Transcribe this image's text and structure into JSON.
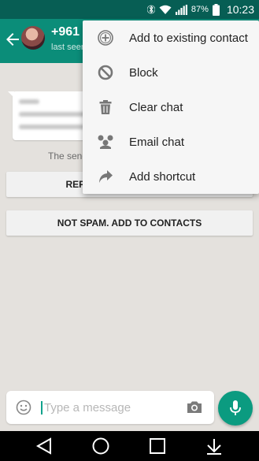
{
  "status_bar": {
    "battery": "87%",
    "time": "10:23"
  },
  "header": {
    "contact_name": "+961",
    "contact_status": "last seen"
  },
  "chat": {
    "sender_note": "The sender",
    "report_label": "REPORT SPAM AND BLOCK",
    "not_spam_label": "NOT SPAM. ADD TO CONTACTS"
  },
  "composer": {
    "placeholder": "Type a message"
  },
  "menu": {
    "items": [
      {
        "label": "Add to existing contact",
        "icon": "add-circle-icon"
      },
      {
        "label": "Block",
        "icon": "block-icon"
      },
      {
        "label": "Clear chat",
        "icon": "trash-icon"
      },
      {
        "label": "Email chat",
        "icon": "email-chat-icon"
      },
      {
        "label": "Add shortcut",
        "icon": "shortcut-arrow-icon"
      }
    ]
  },
  "colors": {
    "status_bar": "#075e54",
    "app_bar": "#0b8d79",
    "accent": "#0b9b80",
    "chat_background": "#e4e1dd"
  }
}
